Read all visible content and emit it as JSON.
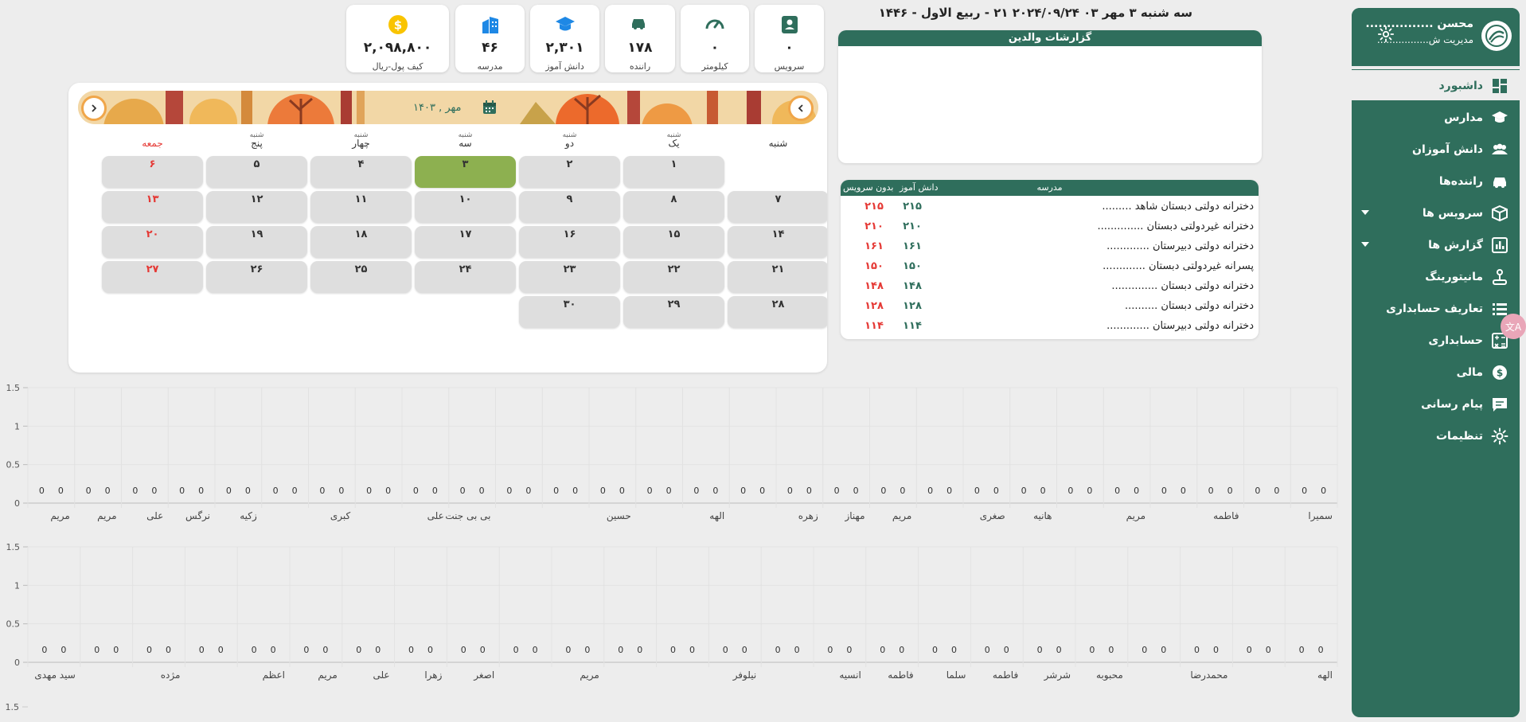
{
  "sidebar": {
    "user_name": "محسن ................",
    "user_role": "مدیریت ش.................",
    "items": [
      {
        "label": "داشبورد",
        "icon": "dashboard-icon",
        "active": true
      },
      {
        "label": "مدارس",
        "icon": "school-icon"
      },
      {
        "label": "دانش آموزان",
        "icon": "students-icon"
      },
      {
        "label": "راننده‌ها",
        "icon": "car-icon"
      },
      {
        "label": "سرویس ها",
        "icon": "box-icon",
        "expandable": true
      },
      {
        "label": "گزارش ها",
        "icon": "report-icon",
        "expandable": true
      },
      {
        "label": "مانیتورینگ",
        "icon": "joystick-icon"
      },
      {
        "label": "تعاریف حسابداری",
        "icon": "list-icon"
      },
      {
        "label": "حسابداری",
        "icon": "calculator-icon"
      },
      {
        "label": "مالی",
        "icon": "dollar-icon"
      },
      {
        "label": "پیام رسانی",
        "icon": "message-icon"
      },
      {
        "label": "تنظیمات",
        "icon": "gear-icon"
      }
    ]
  },
  "date_line": "سه شنبه ۳ مهر ۰۳  ۲۰۲۴/۰۹/۲۴  ۲۱ - ربیع الاول - ۱۴۴۶",
  "cards": [
    {
      "label": "سرویس",
      "value": "۰",
      "icon": "person-badge-icon",
      "color": "#2f6e5c"
    },
    {
      "label": "کیلومتر",
      "value": "۰",
      "icon": "speedometer-icon",
      "color": "#2f6e5c"
    },
    {
      "label": "راننده",
      "value": "۱۷۸",
      "icon": "car-icon",
      "color": "#2f6e5c"
    },
    {
      "label": "دانش آموز",
      "value": "۲,۳۰۱",
      "icon": "graduation-cap-icon",
      "color": "#1e88e5"
    },
    {
      "label": "مدرسه",
      "value": "۴۶",
      "icon": "building-icon",
      "color": "#1e88e5"
    },
    {
      "label": "کیف پول-ریال",
      "value": "۲,۰۹۸,۸۰۰",
      "icon": "dollar-coin-icon",
      "color": "#f9c400"
    }
  ],
  "reports": {
    "title": "گزارشات والدین"
  },
  "schools": {
    "headers": {
      "school": "مدرسه",
      "students": "دانش آموز",
      "no_service": "بدون سرویس"
    },
    "rows": [
      {
        "name": "دخترانه دولتی دبستان شاهد .........",
        "students": "۲۱۵",
        "no_service": "۲۱۵"
      },
      {
        "name": "دخترانه غیردولتی دبستان ..............",
        "students": "۲۱۰",
        "no_service": "۲۱۰"
      },
      {
        "name": "دخترانه دولتی دبیرستان .............",
        "students": "۱۶۱",
        "no_service": "۱۶۱"
      },
      {
        "name": "پسرانه غیردولتی دبستان .............",
        "students": "۱۵۰",
        "no_service": "۱۵۰"
      },
      {
        "name": "دخترانه دولتی دبستان ..............",
        "students": "۱۴۸",
        "no_service": "۱۴۸"
      },
      {
        "name": "دخترانه دولتی دبستان ..........",
        "students": "۱۲۸",
        "no_service": "۱۲۸"
      },
      {
        "name": "دخترانه دولتی دبیرستان .............",
        "students": "۱۱۴",
        "no_service": "۱۱۴"
      }
    ]
  },
  "calendar": {
    "month_label": "مهر , ۱۴۰۳",
    "weekdays": [
      {
        "sup": "",
        "main": "شنبه"
      },
      {
        "sup": "شنبه",
        "main": "یک"
      },
      {
        "sup": "شنبه",
        "main": "دو"
      },
      {
        "sup": "شنبه",
        "main": "سه"
      },
      {
        "sup": "شنبه",
        "main": "چهار"
      },
      {
        "sup": "شنبه",
        "main": "پنج"
      },
      {
        "sup": "",
        "main": "جمعه"
      }
    ],
    "first_col": 1,
    "today": 3,
    "days": [
      "۱",
      "۲",
      "۳",
      "۴",
      "۵",
      "۶",
      "۷",
      "۸",
      "۹",
      "۱۰",
      "۱۱",
      "۱۲",
      "۱۳",
      "۱۴",
      "۱۵",
      "۱۶",
      "۱۷",
      "۱۸",
      "۱۹",
      "۲۰",
      "۲۱",
      "۲۲",
      "۲۳",
      "۲۴",
      "۲۵",
      "۲۶",
      "۲۷",
      "۲۸",
      "۲۹",
      "۳۰"
    ]
  },
  "chart_data": [
    {
      "type": "bar",
      "ylim": [
        0,
        1.5
      ],
      "yticks": [
        "0",
        "0.5",
        "1",
        "1.5"
      ],
      "grid": true,
      "categories": [
        "سمیرا",
        "",
        "فاطمه",
        "",
        "مریم",
        "",
        "هانیه",
        "صغری",
        "",
        "مریم",
        "مهناز",
        "زهره",
        "",
        "الهه",
        "",
        "حسین",
        "",
        "",
        "بی بی جنت",
        "علی",
        "",
        "کبری",
        "",
        "زکیه",
        "نرگس",
        "علی",
        "مریم",
        "مریم"
      ],
      "bar_labels": [
        "0",
        "0"
      ],
      "series": [
        {
          "values": [
            0,
            0,
            0,
            0,
            0,
            0,
            0,
            0,
            0,
            0,
            0,
            0,
            0,
            0,
            0,
            0,
            0,
            0,
            0,
            0,
            0,
            0,
            0,
            0,
            0,
            0,
            0,
            0
          ]
        },
        {
          "values": [
            0,
            0,
            0,
            0,
            0,
            0,
            0,
            0,
            0,
            0,
            0,
            0,
            0,
            0,
            0,
            0,
            0,
            0,
            0,
            0,
            0,
            0,
            0,
            0,
            0,
            0,
            0,
            0
          ]
        }
      ]
    },
    {
      "type": "bar",
      "ylim": [
        0,
        1.5
      ],
      "yticks": [
        "0",
        "0.5",
        "1",
        "1.5"
      ],
      "grid": true,
      "categories": [
        "الهه",
        "",
        "محمدرضا",
        "",
        "محبوبه",
        "شرشر",
        "فاطمه",
        "سلما",
        "فاطمه",
        "انسیه",
        "",
        "نیلوفر",
        "",
        "",
        "مریم",
        "",
        "اصغر",
        "زهرا",
        "علی",
        "مریم",
        "اعظم",
        "",
        "مژده",
        "",
        "سید مهدی"
      ],
      "series": [
        {
          "values": [
            0,
            0,
            0,
            0,
            0,
            0,
            0,
            0,
            0,
            0,
            0,
            0,
            0,
            0,
            0,
            0,
            0,
            0,
            0,
            0,
            0,
            0,
            0,
            0,
            0
          ]
        },
        {
          "values": [
            0,
            0,
            0,
            0,
            0,
            0,
            0,
            0,
            0,
            0,
            0,
            0,
            0,
            0,
            0,
            0,
            0,
            0,
            0,
            0,
            0,
            0,
            0,
            0,
            0
          ]
        }
      ]
    },
    {
      "type": "bar",
      "ylim": [
        0,
        1.5
      ],
      "yticks": [
        "1.5"
      ],
      "categories": [],
      "series": []
    }
  ]
}
